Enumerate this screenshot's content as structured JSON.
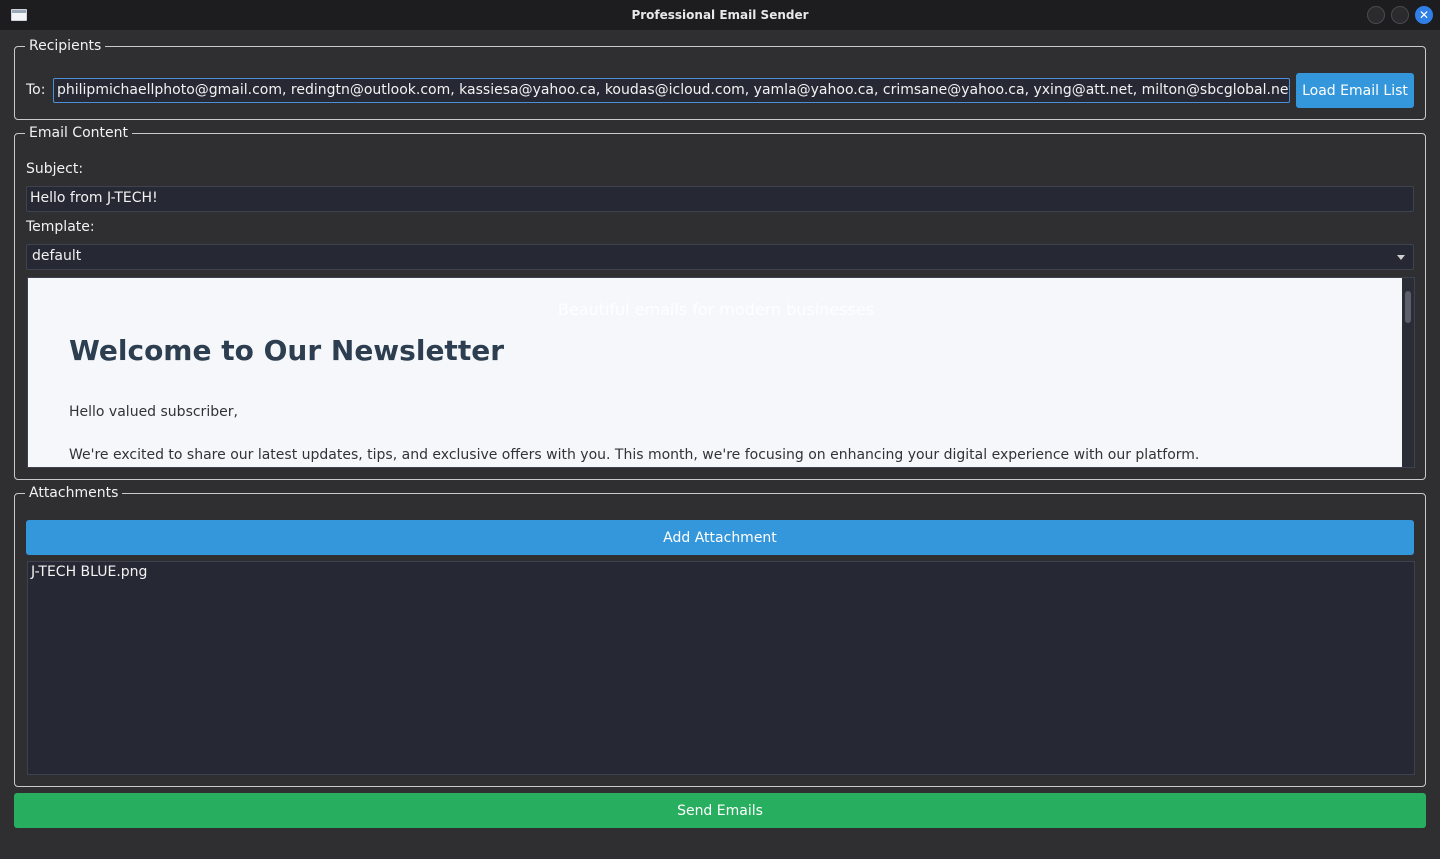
{
  "window": {
    "title": "Professional Email Sender"
  },
  "recipients": {
    "legend": "Recipients",
    "to_label": "To:",
    "to_value": "philipmichaellphoto@gmail.com, redingtn@outlook.com, kassiesa@yahoo.ca, koudas@icloud.com, yamla@yahoo.ca, crimsane@yahoo.ca, yxing@att.net, milton@sbcglobal.net, trieuvan@yahoo.com",
    "load_button": "Load Email List"
  },
  "content": {
    "legend": "Email Content",
    "subject_label": "Subject:",
    "subject_value": "Hello from J-TECH!",
    "template_label": "Template:",
    "template_value": "default",
    "preview": {
      "tagline": "Beautiful emails for modern businesses",
      "headline": "Welcome to Our Newsletter",
      "greeting": "Hello valued subscriber,",
      "intro": "We're excited to share our latest updates, tips, and exclusive offers with you. This month, we're focusing on enhancing your digital experience with our platform."
    }
  },
  "attachments": {
    "legend": "Attachments",
    "add_button": "Add Attachment",
    "files": [
      "J-TECH BLUE.png"
    ]
  },
  "send_button": "Send Emails",
  "icons": {
    "close": "close-icon",
    "dropdown": "chevron-down-icon",
    "app": "window-icon"
  },
  "colors": {
    "accent_blue": "#3497dc",
    "send_green": "#27ae5f",
    "preview_bg": "#f5f7fb",
    "headline": "#2c3e50"
  }
}
